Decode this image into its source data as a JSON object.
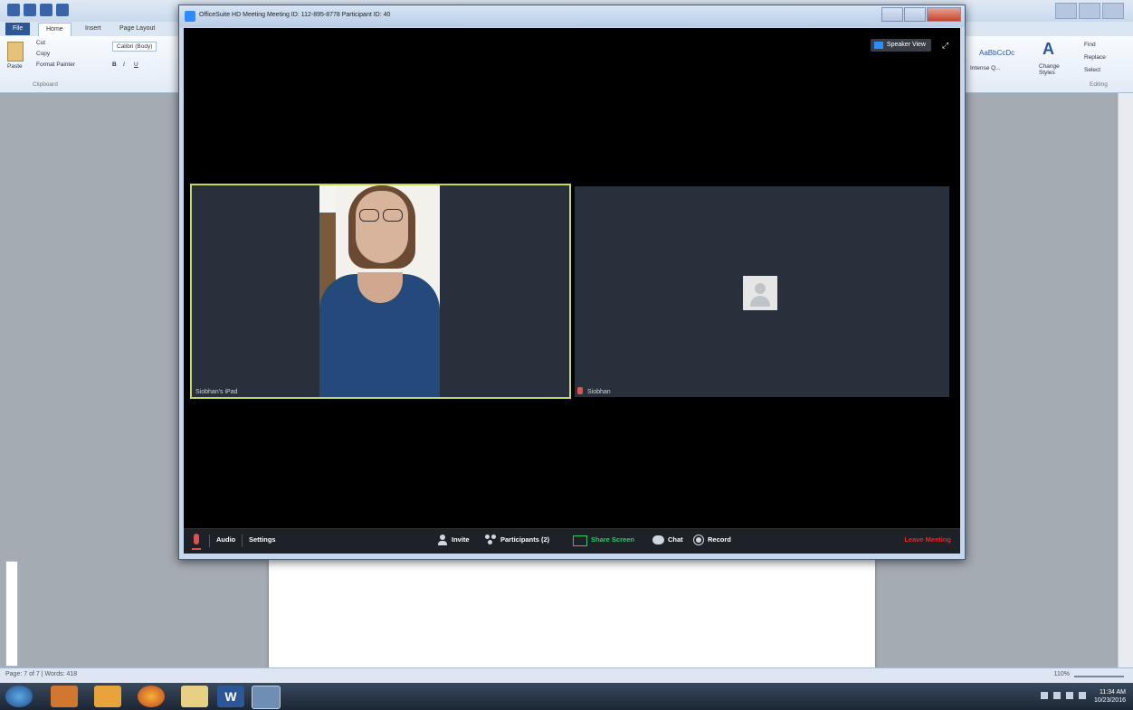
{
  "zoom_window": {
    "title": "OfficeSuite HD Meeting Meeting ID: 112-895-8778 Participant ID: 40",
    "speaker_view_label": "Speaker View",
    "tiles": [
      {
        "name": "Siobhan's iPad"
      },
      {
        "name": "Siobhan"
      }
    ],
    "toolbar": {
      "audio": "Audio",
      "settings": "Settings",
      "invite": "Invite",
      "participants": "Participants (2)",
      "share_screen": "Share Screen",
      "chat": "Chat",
      "record": "Record",
      "leave": "Leave Meeting"
    },
    "colors": {
      "active_speaker_border": "#c3d75a",
      "share_green": "#2fc96a",
      "leave_red": "#e02828"
    }
  },
  "word": {
    "tabs": [
      "File",
      "Home",
      "Insert",
      "Page Layout"
    ],
    "clipboard": {
      "paste": "Paste",
      "cut": "Cut",
      "copy": "Copy",
      "format_painter": "Format Painter",
      "group_label": "Clipboard"
    },
    "font_name": "Calibri (Body)",
    "styles": {
      "style1": "AaBbCcDc",
      "intense": "Intense Q...",
      "change_styles": "Change Styles"
    },
    "editing": {
      "find": "Find",
      "replace": "Replace",
      "select": "Select",
      "group_label": "Editing"
    },
    "status": {
      "page": "Page: 7 of 7",
      "words": "Words: 418",
      "zoom": "110%"
    }
  },
  "taskbar": {
    "time": "11:34 AM",
    "date": "10/23/2016"
  }
}
